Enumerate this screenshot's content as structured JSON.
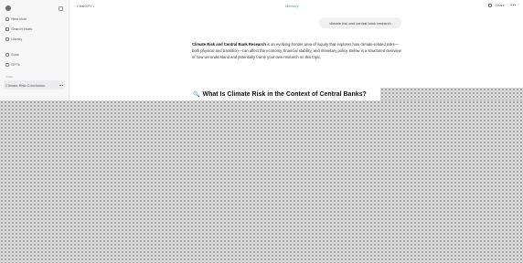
{
  "sidebar": {
    "items": [
      {
        "label": "New chat",
        "icon": "pencil-icon"
      },
      {
        "label": "Search chats",
        "icon": "search-icon"
      },
      {
        "label": "Library",
        "icon": "library-icon"
      },
      {
        "label": "Sora",
        "icon": "sora-icon"
      },
      {
        "label": "GPTs",
        "icon": "gpts-icon"
      }
    ],
    "section_label": "Chats",
    "active_chat": "Climate Risk Conclusion"
  },
  "topbar": {
    "model_label": "ChatGPT",
    "center_label": "Memory",
    "share_label": "Share"
  },
  "conversation": {
    "user_message": "climate risk and central bank research",
    "answer_bold": "Climate Risk and Central Bank Research",
    "answer_text": " is an evolving frontier area of inquiry that explores how climate-related risks—both physical and transition—can affect the economy, financial stability, and monetary policy. Below is a structured overview of how we understand and potentially frame your own research on this topic.",
    "heading": "What Is Climate Risk in the Context of Central Banks?"
  }
}
